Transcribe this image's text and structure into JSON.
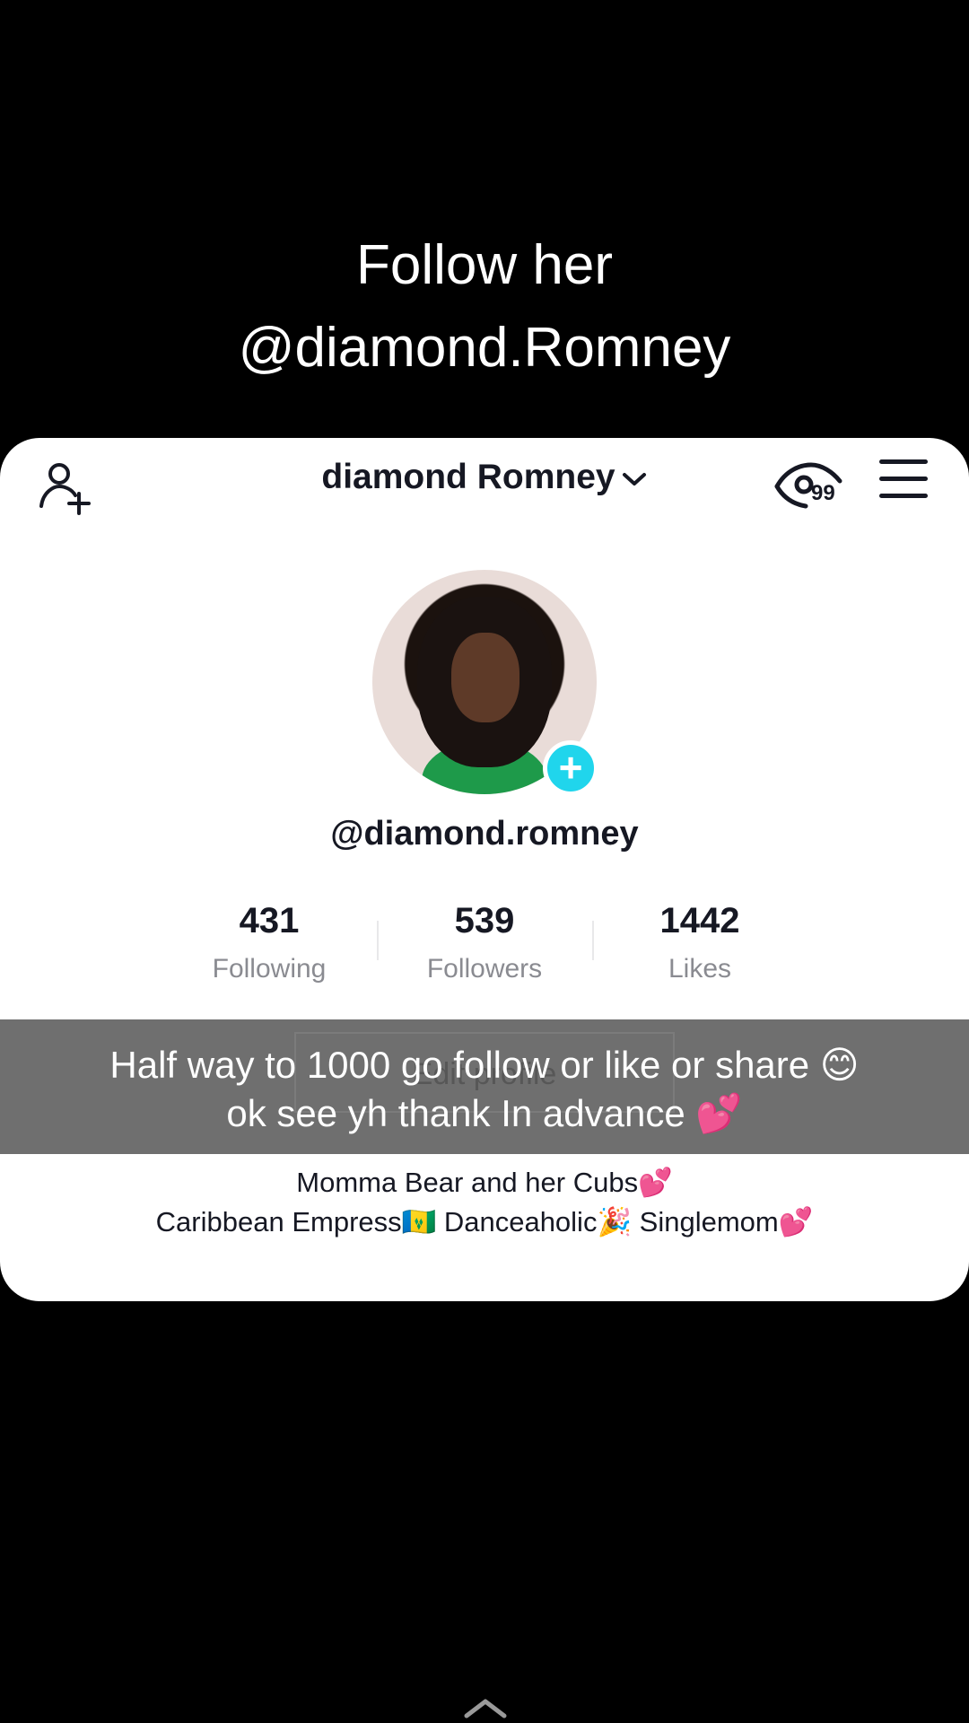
{
  "overlay": {
    "line1": "Follow her",
    "line2": "@diamond.Romney"
  },
  "profile": {
    "account_name": "diamond Romney",
    "views_badge": "99",
    "handle": "@diamond.romney",
    "stats": [
      {
        "value": "431",
        "label": "Following"
      },
      {
        "value": "539",
        "label": "Followers"
      },
      {
        "value": "1442",
        "label": "Likes"
      }
    ],
    "edit_profile_label": "Edit profile",
    "bio_line1": "Momma Bear and her Cubs💕",
    "bio_line2": "Caribbean Empress🇻🇨 Danceaholic🎉 Singlemom💕"
  },
  "caption": {
    "line1": "Half way to 1000 go follow or like or share 😊",
    "line2": "ok see yh thank In advance 💕"
  },
  "icons": {
    "add_user": "add-user-icon",
    "eye": "eye-icon",
    "menu": "hamburger-menu-icon",
    "swipe": "chevron-up-icon"
  },
  "colors": {
    "background": "#000000",
    "card": "#ffffff",
    "accent_plus": "#20d5ec",
    "caption_bar": "#6f6f6f"
  }
}
